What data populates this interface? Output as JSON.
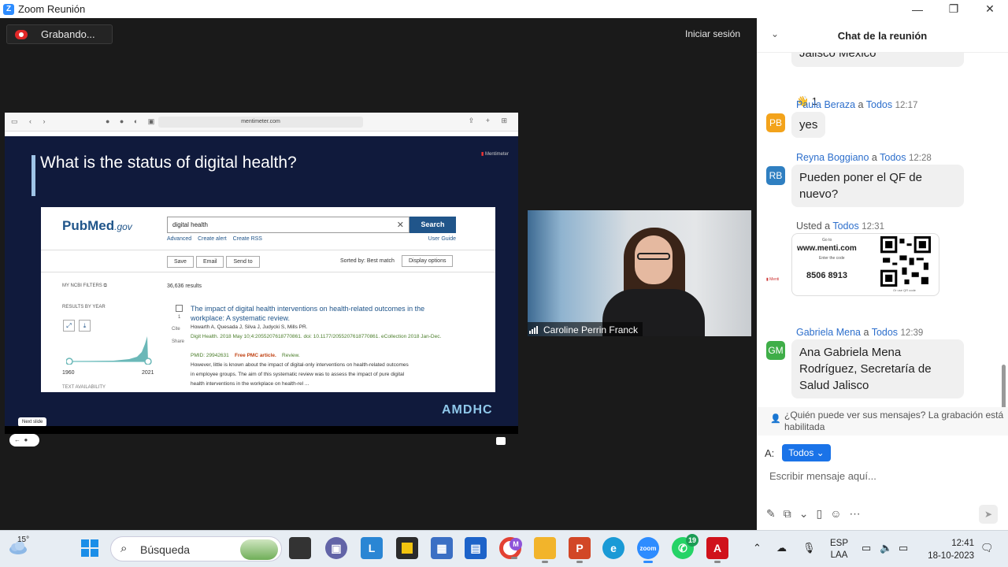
{
  "window": {
    "title": "Zoom Reunión",
    "app_icon": "Z"
  },
  "meeting": {
    "recording_label": "Grabando...",
    "signin_label": "Iniciar sesión"
  },
  "shared_screen": {
    "url": "mentimeter.com",
    "slide_title": "What is the status of digital health?",
    "menti_logo": "Mentimeter",
    "pubmed": {
      "logo_main": "PubMed",
      "logo_suffix": ".gov",
      "search_value": "digital health",
      "search_button": "Search",
      "links": [
        "Advanced",
        "Create alert",
        "Create RSS"
      ],
      "user_guide": "User Guide",
      "actions": [
        "Save",
        "Email",
        "Send to"
      ],
      "sort_label": "Sorted by: Best match",
      "display_options": "Display options",
      "filters_label": "MY NCBI FILTERS",
      "results_count": "36,636 results",
      "results_by_year": "RESULTS BY YEAR",
      "year_start": "1960",
      "year_end": "2021",
      "text_availability": "TEXT AVAILABILITY",
      "article": {
        "number": "1",
        "title": "The impact of digital health interventions on health-related outcomes in the workplace: A systematic review.",
        "authors": "Howarth A, Quesada J, Silva J, Judycki S, Mills PR.",
        "journal": "Digit Health. 2018 May 10;4:2055207618770861. doi: 10.1177/2055207618770861. eCollection 2018 Jan-Dec.",
        "pmid": "PMID: 29942631",
        "free": "Free PMC article.",
        "type": "Review.",
        "snippet1": "However, little is known about the impact of digital-only interventions on health-related outcomes",
        "snippet2": "in employee groups. The aim of this systematic review was to assess the impact of pure digital",
        "snippet3": "health interventions in the workplace on health-rel ...",
        "cite": "Cite",
        "share": "Share"
      }
    },
    "next_slide_tooltip": "Next slide",
    "brand": "AMDHC"
  },
  "video": {
    "participant_name": "Caroline Perrin Franck"
  },
  "chat": {
    "title": "Chat de la reunión",
    "messages": [
      {
        "partial_text": "Jalisco México",
        "reaction": "👋 1"
      },
      {
        "initials": "PB",
        "avatar_color": "#f3a31b",
        "sender": "Paula Beraza",
        "to_word": "a",
        "recipient": "Todos",
        "time": "12:17",
        "text": "yes"
      },
      {
        "initials": "RB",
        "avatar_color": "#2f7fc1",
        "sender": "Reyna Boggiano",
        "to_word": "a",
        "recipient": "Todos",
        "time": "12:28",
        "text": "Pueden poner el QF de nuevo?"
      },
      {
        "sender": "Usted",
        "to_word": "a",
        "recipient": "Todos",
        "time": "12:31",
        "qr_card": {
          "goto": "Go to",
          "site": "www.menti.com",
          "enter": "Enter the code",
          "code": "8506 8913",
          "qr_caption": "Or use QR code"
        }
      },
      {
        "initials": "GM",
        "avatar_color": "#3fae48",
        "sender": "Gabriela Mena",
        "to_word": "a",
        "recipient": "Todos",
        "time": "12:39",
        "text": "Ana Gabriela Mena Rodríguez, Secretaría de Salud Jalisco"
      }
    ],
    "privacy_text": "¿Quién puede ver sus mensajes? La grabación está habilitada",
    "to_label": "A:",
    "to_value": "Todos",
    "input_placeholder": "Escribir mensaje aquí..."
  },
  "taskbar": {
    "temperature": "15°",
    "search_label": "Búsqueda",
    "meet_badge": "M",
    "whatsapp_badge": "19",
    "zoom_label": "zoom",
    "language_line1": "ESP",
    "language_line2": "LAA",
    "time": "12:41",
    "date": "18-10-2023"
  }
}
